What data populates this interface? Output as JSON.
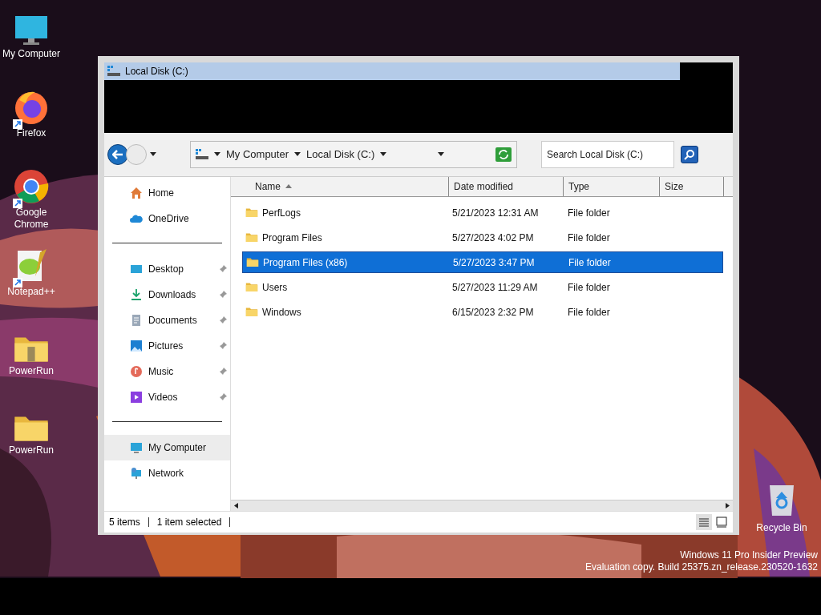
{
  "desktop_icons": [
    {
      "label": "My Computer",
      "kind": "monitor",
      "shortcut": false
    },
    {
      "label": "Firefox",
      "kind": "firefox",
      "shortcut": true
    },
    {
      "label": "Google Chrome",
      "kind": "chrome",
      "shortcut": true
    },
    {
      "label": "Notepad++",
      "kind": "notepad",
      "shortcut": true
    },
    {
      "label": "PowerRun",
      "kind": "zip-folder",
      "shortcut": false
    },
    {
      "label": "PowerRun",
      "kind": "folder",
      "shortcut": false
    }
  ],
  "recycle_bin": {
    "label": "Recycle Bin"
  },
  "window": {
    "title": "Local Disk (C:)",
    "address": {
      "crumbs": [
        "My Computer",
        "Local Disk (C:)"
      ]
    },
    "search": {
      "placeholder": "Search Local Disk (C:)"
    },
    "sidebar": {
      "groups": [
        {
          "items": [
            {
              "label": "Home",
              "kind": "home",
              "pinned": false,
              "selected": false
            },
            {
              "label": "OneDrive",
              "kind": "cloud",
              "pinned": false,
              "selected": false
            }
          ]
        },
        {
          "items": [
            {
              "label": "Desktop",
              "kind": "desktop",
              "pinned": true,
              "selected": false
            },
            {
              "label": "Downloads",
              "kind": "download",
              "pinned": true,
              "selected": false
            },
            {
              "label": "Documents",
              "kind": "document",
              "pinned": true,
              "selected": false
            },
            {
              "label": "Pictures",
              "kind": "pictures",
              "pinned": true,
              "selected": false
            },
            {
              "label": "Music",
              "kind": "music",
              "pinned": true,
              "selected": false
            },
            {
              "label": "Videos",
              "kind": "video",
              "pinned": true,
              "selected": false
            }
          ]
        },
        {
          "items": [
            {
              "label": "My Computer",
              "kind": "monitor",
              "pinned": false,
              "selected": true
            },
            {
              "label": "Network",
              "kind": "network",
              "pinned": false,
              "selected": false
            }
          ]
        }
      ]
    },
    "columns": [
      {
        "label": "Name",
        "sorted": true
      },
      {
        "label": "Date modified",
        "sorted": false
      },
      {
        "label": "Type",
        "sorted": false
      },
      {
        "label": "Size",
        "sorted": false
      }
    ],
    "rows": [
      {
        "name": "PerfLogs",
        "date": "5/21/2023 12:31 AM",
        "type": "File folder",
        "selected": false
      },
      {
        "name": "Program Files",
        "date": "5/27/2023 4:02 PM",
        "type": "File folder",
        "selected": false
      },
      {
        "name": "Program Files (x86)",
        "date": "5/27/2023 3:47 PM",
        "type": "File folder",
        "selected": true
      },
      {
        "name": "Users",
        "date": "5/27/2023 11:29 AM",
        "type": "File folder",
        "selected": false
      },
      {
        "name": "Windows",
        "date": "6/15/2023 2:32 PM",
        "type": "File folder",
        "selected": false
      }
    ],
    "status": {
      "count": "5 items",
      "selection": "1 item selected"
    }
  },
  "os_notice": [
    "Windows 11 Pro Insider Preview",
    "Evaluation copy. Build 25375.zn_release.230520-1632"
  ]
}
